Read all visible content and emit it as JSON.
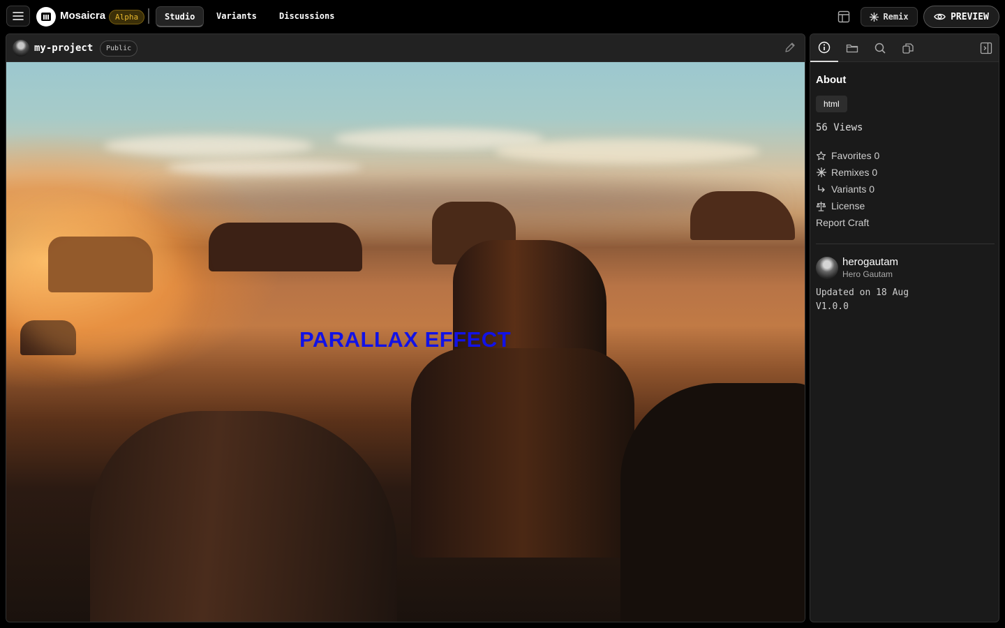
{
  "header": {
    "brand": "Mosaicra",
    "badge": "Alpha",
    "tabs": [
      {
        "label": "Studio",
        "active": true
      },
      {
        "label": "Variants",
        "active": false
      },
      {
        "label": "Discussions",
        "active": false
      }
    ],
    "remix_label": "Remix",
    "preview_label": "PREVIEW",
    "icons": [
      "menu-icon",
      "logo-icon",
      "layout-icon",
      "sparkle-icon",
      "eye-icon"
    ]
  },
  "project": {
    "name": "my-project",
    "visibility": "Public",
    "edit_icon": "pencil-icon"
  },
  "preview": {
    "heading": "PARALLAX EFFECT",
    "heading_color": "#1212e6",
    "background": "desert sunset landscape photo"
  },
  "sidebar": {
    "tabs": [
      "info-icon",
      "folder-icon",
      "search-icon",
      "copy-icon"
    ],
    "collapse_icon": "panel-collapse-icon",
    "about_title": "About",
    "tag": "html",
    "views": "56 Views",
    "stats": [
      {
        "icon": "star-icon",
        "label": "Favorites 0"
      },
      {
        "icon": "sparkle-icon",
        "label": "Remixes 0"
      },
      {
        "icon": "branch-icon",
        "label": "Variants 0"
      },
      {
        "icon": "scale-icon",
        "label": "License"
      }
    ],
    "report": "Report Craft",
    "author": {
      "handle": "herogautam",
      "name": "Hero Gautam"
    },
    "updated": "Updated on 18 Aug",
    "version": "V1.0.0"
  },
  "colors": {
    "background": "#000000",
    "panel": "#1e1e1e",
    "badge_text": "#e9b92e",
    "badge_bg": "#3b2f08"
  }
}
